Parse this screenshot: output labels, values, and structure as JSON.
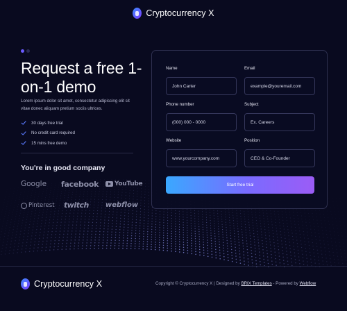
{
  "header": {
    "brand": "Cryptocurrency X",
    "logo_icon": "crypto-logo-icon"
  },
  "hero": {
    "title": "Request a free 1-on-1 demo",
    "description": "Lorem ipsum dolor sit amet, consectetur adipiscing elit sit vitae donec aliquam pretium sociis ultrices.",
    "benefits": [
      "30 days free trial",
      "No credit card required",
      "15 mins free demo"
    ],
    "benefit_icon": "check-icon"
  },
  "companies": {
    "title": "You're in good company",
    "logos": {
      "google": "Google",
      "facebook": "facebook",
      "youtube": "YouTube",
      "pinterest": "Pinterest",
      "twitch": "twitch",
      "webflow": "webflow"
    }
  },
  "form": {
    "name": {
      "label": "Name",
      "placeholder": "John Carter"
    },
    "email": {
      "label": "Email",
      "placeholder": "example@youremail.com"
    },
    "phone": {
      "label": "Phone number",
      "placeholder": "(000) 000 - 0000"
    },
    "subject": {
      "label": "Subject",
      "placeholder": "Ex. Careers"
    },
    "website": {
      "label": "Website",
      "placeholder": "www.yourcompany.com"
    },
    "position": {
      "label": "Position",
      "placeholder": "CEO & Co-Founder"
    },
    "submit_label": "Start free trial"
  },
  "footer": {
    "brand": "Cryptocurrency X",
    "copyright_prefix": "Copyright © Cryptocurrency X | Designed by ",
    "designer_link": "BRIX Templates",
    "powered_prefix": " - Powered by ",
    "powered_link": "Webflow"
  },
  "colors": {
    "background": "#090a1f",
    "accent_start": "#3aa8ff",
    "accent_end": "#9b5cf6",
    "logo_gradient_start": "#3d8bff",
    "logo_gradient_end": "#7b3bff"
  }
}
